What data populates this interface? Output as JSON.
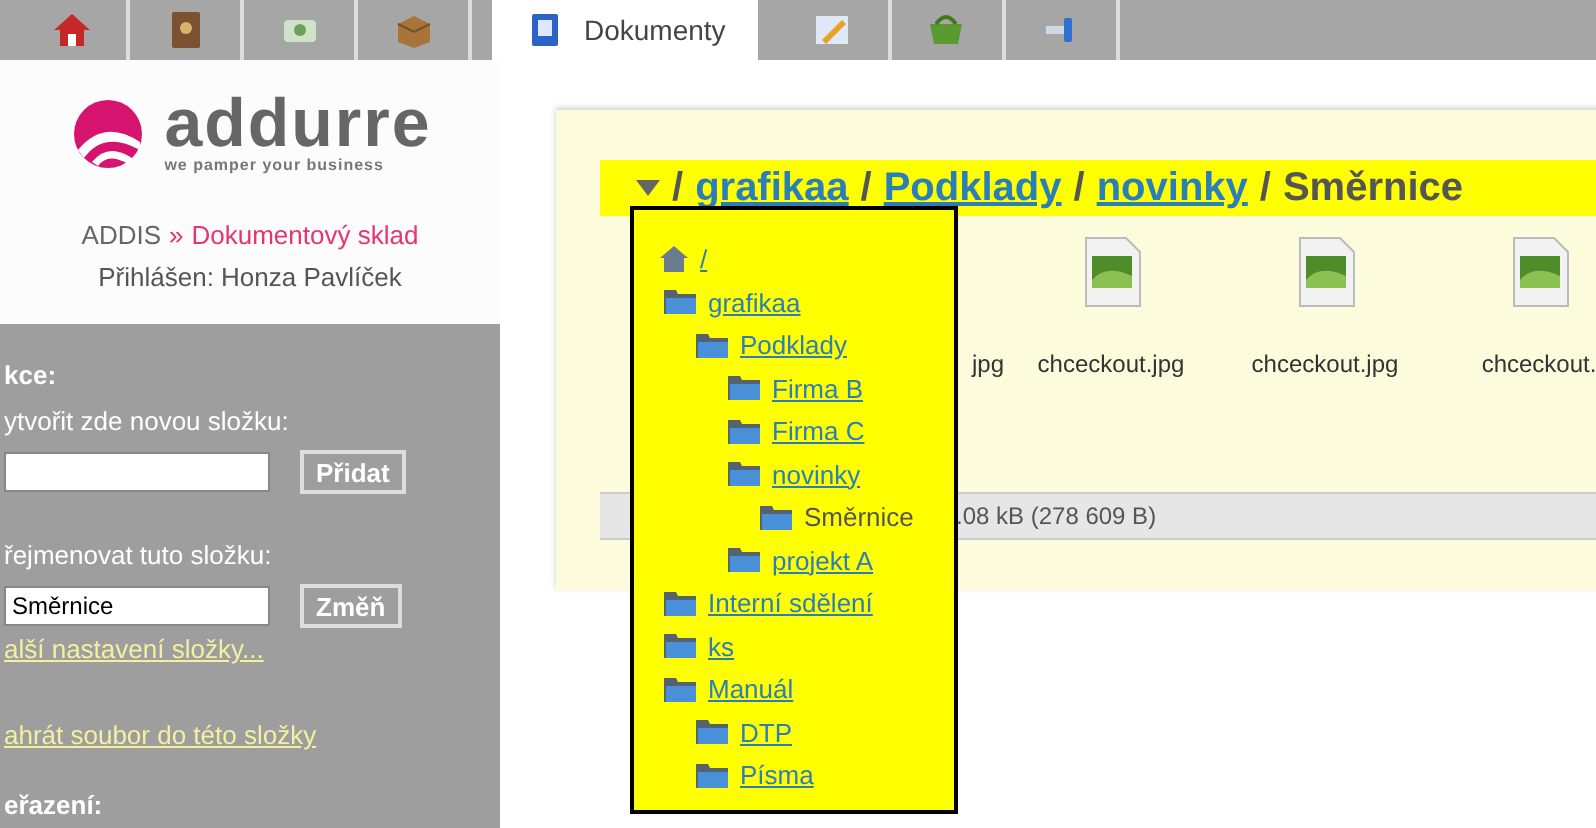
{
  "nav": {
    "tabs": [
      {
        "selected": false
      },
      {
        "selected": false
      },
      {
        "selected": false
      },
      {
        "selected": false
      },
      {
        "label": "Dokumenty",
        "selected": true
      },
      {
        "selected": false
      },
      {
        "selected": false
      },
      {
        "selected": false
      }
    ]
  },
  "logo": {
    "name": "addurre",
    "tagline": "we pamper your business"
  },
  "header": {
    "app": "ADDIS",
    "separator": "»",
    "section": "Dokumentový sklad",
    "user": "Přihlášen: Honza Pavlíček"
  },
  "sidebar": {
    "items": [
      {
        "kind": "heading",
        "text": "kce:"
      },
      {
        "kind": "label",
        "text": "ytvořit zde novou složku:"
      },
      {
        "kind": "form",
        "value": "",
        "button": "Přidat"
      },
      {
        "kind": "label",
        "text": "řejmenovat tuto složku:"
      },
      {
        "kind": "form",
        "value": "Směrnice",
        "button": "Změň"
      },
      {
        "kind": "link",
        "text": "alší nastavení složky..."
      },
      {
        "kind": "link",
        "text": "ahrát soubor do této složky"
      },
      {
        "kind": "heading",
        "text": "eřazení:"
      }
    ]
  },
  "breadcrumb": [
    {
      "kind": "separator",
      "text": "/"
    },
    {
      "kind": "link",
      "text": "grafikaa"
    },
    {
      "kind": "separator",
      "text": "/"
    },
    {
      "kind": "link",
      "text": "Podklady"
    },
    {
      "kind": "separator",
      "text": "/"
    },
    {
      "kind": "link",
      "text": "novinky"
    },
    {
      "kind": "separator",
      "text": "/"
    },
    {
      "kind": "current",
      "text": "Směrnice"
    }
  ],
  "files": [
    {
      "name": "jpg",
      "kind": "fragment"
    },
    {
      "name": "chceckout.jpg",
      "kind": "image"
    },
    {
      "name": "chceckout.jpg",
      "kind": "image"
    },
    {
      "name": "chceckout.",
      "kind": "image"
    }
  ],
  "status_bar": ".08 kB (278 609 B)",
  "folder_tree": [
    {
      "label": "/",
      "selected": false,
      "children": [
        {
          "label": "grafikaa",
          "selected": false,
          "children": [
            {
              "label": "Podklady",
              "selected": false,
              "children": [
                {
                  "label": "Firma B",
                  "selected": false
                },
                {
                  "label": "Firma C",
                  "selected": false
                },
                {
                  "label": "novinky",
                  "selected": false,
                  "children": [
                    {
                      "label": "Směrnice",
                      "selected": true
                    }
                  ]
                },
                {
                  "label": "projekt A",
                  "selected": false
                }
              ]
            }
          ]
        },
        {
          "label": "Interní sdělení",
          "selected": false
        },
        {
          "label": "ks",
          "selected": false
        },
        {
          "label": "Manuál",
          "selected": false,
          "children": [
            {
              "label": "DTP",
              "selected": false
            },
            {
              "label": "Písma",
              "selected": false
            }
          ]
        }
      ]
    }
  ]
}
